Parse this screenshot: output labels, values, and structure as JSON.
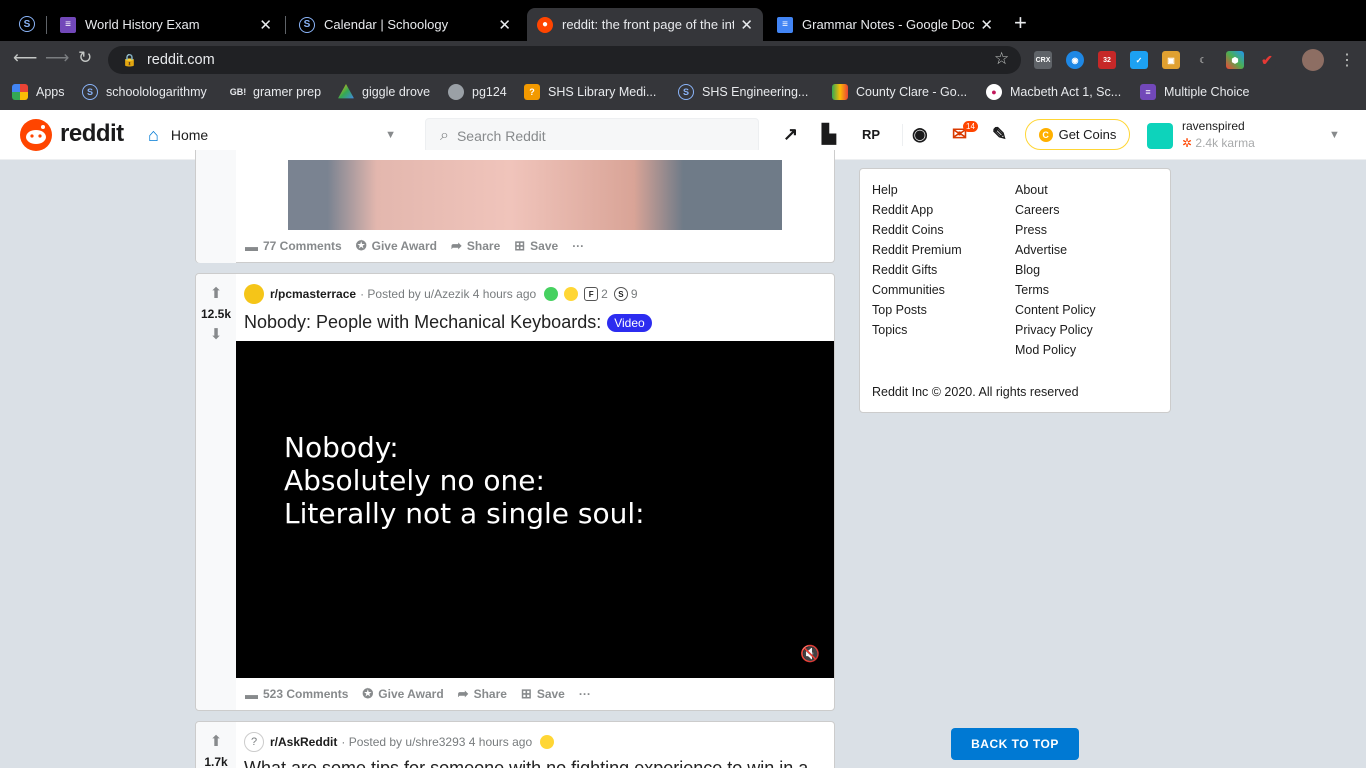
{
  "browser": {
    "tabs": [
      {
        "label": "World History Exam",
        "icon": "forms-icon"
      },
      {
        "label": "Calendar | Schoology",
        "icon": "schoology-icon"
      },
      {
        "label": "reddit: the front page of the int",
        "icon": "reddit-icon",
        "active": true
      },
      {
        "label": "Grammar Notes - Google Docs",
        "icon": "docs-icon"
      }
    ],
    "new_tab": "+",
    "close": "✕",
    "url": "reddit.com",
    "extensions": [
      "CRX",
      "32"
    ],
    "bookmarks": [
      {
        "label": "Apps"
      },
      {
        "label": "schoolologarithmy"
      },
      {
        "label": "gramer prep",
        "icon_text": "GB!"
      },
      {
        "label": "giggle drove"
      },
      {
        "label": "pg124"
      },
      {
        "label": "SHS Library Medi..."
      },
      {
        "label": "SHS Engineering..."
      },
      {
        "label": "County Clare - Go..."
      },
      {
        "label": "Macbeth Act 1, Sc..."
      },
      {
        "label": "Multiple Choice"
      }
    ]
  },
  "reddit": {
    "logo_text": "reddit",
    "home_label": "Home",
    "search_placeholder": "Search Reddit",
    "mail_badge": "14",
    "get_coins": "Get Coins",
    "username": "ravenspired",
    "karma": "2.4k karma"
  },
  "posts": [
    {
      "comments": "77 Comments",
      "give_award": "Give Award",
      "share": "Share",
      "save": "Save",
      "more": "···"
    },
    {
      "score": "12.5k",
      "subreddit": "r/pcmasterrace",
      "posted_by": "· Posted by u/Azezik 4 hours ago",
      "award_count_1": "2",
      "award_count_2": "9",
      "title": "Nobody: People with Mechanical Keyboards:",
      "flair": "Video",
      "video_lines": [
        "Nobody:",
        "Absolutely no one:",
        "Literally not a single soul:"
      ],
      "comments": "523 Comments",
      "give_award": "Give Award",
      "share": "Share",
      "save": "Save",
      "more": "···"
    },
    {
      "score": "1.7k",
      "subreddit": "r/AskReddit",
      "posted_by": "· Posted by u/shre3293 4 hours ago",
      "title": "What are some tips for someone with no fighting experience to win in a"
    }
  ],
  "sidebar": {
    "left_links": [
      "Help",
      "Reddit App",
      "Reddit Coins",
      "Reddit Premium",
      "Reddit Gifts",
      "Communities",
      "Top Posts",
      "Topics"
    ],
    "right_links": [
      "About",
      "Careers",
      "Press",
      "Advertise",
      "Blog",
      "Terms",
      "Content Policy",
      "Privacy Policy",
      "Mod Policy"
    ],
    "copyright": "Reddit Inc © 2020. All rights reserved"
  },
  "back_to_top": "BACK TO TOP",
  "colors": {
    "reddit_orange": "#ff4500",
    "blue": "#0079d3",
    "page_bg": "#dae0e6"
  }
}
